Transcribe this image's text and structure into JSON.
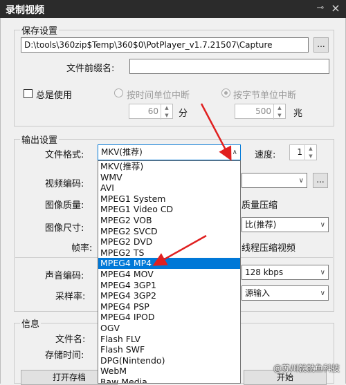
{
  "window": {
    "title": "录制视频",
    "pin_icon": "pin-icon",
    "close_icon": "close-icon"
  },
  "save": {
    "group_label": "保存设置",
    "path": "D:\\tools\\360zip$Temp\\360$0\\PotPlayer_v1.7.21507\\Capture",
    "browse_label": "...",
    "prefix_label": "文件前缀名:",
    "prefix_value": "",
    "always_use_label": "总是使用",
    "time_split_label": "按时间单位中断",
    "byte_split_label": "按字节单位中断",
    "time_value": "60",
    "time_unit": "分",
    "byte_value": "500",
    "byte_unit": "兆"
  },
  "output": {
    "group_label": "输出设置",
    "format_label": "文件格式:",
    "format_value": "MKV(推荐)",
    "speed_label": "速度:",
    "speed_value": "1",
    "video_codec_label": "视频编码:",
    "video_browse_label": "...",
    "image_quality_label": "图像质量:",
    "quality_option_label": "质量压缩",
    "image_size_label": "图像尺寸:",
    "size_value": "比(推荐)",
    "frame_rate_label": "帧率:",
    "multithread_label": "线程压缩视频",
    "audio_codec_label": "声音编码:",
    "audio_bitrate": "128 kbps",
    "sample_rate_label": "采样率:",
    "sample_value": "源输入"
  },
  "info": {
    "group_label": "信息",
    "filename_label": "文件名:",
    "storage_time_label": "存储时间:",
    "open_folder_label": "打开存档",
    "start_label": "开始"
  },
  "format_dropdown": {
    "items": [
      "MKV(推荐)",
      "WMV",
      "AVI",
      "MPEG1 System",
      "MPEG1 Video CD",
      "MPEG2 VOB",
      "MPEG2 SVCD",
      "MPEG2 DVD",
      "MPEG2 TS",
      "MPEG4 MP4",
      "MPEG4 MOV",
      "MPEG4 3GP1",
      "MPEG4 3GP2",
      "MPEG4 PSP",
      "MPEG4 IPOD",
      "OGV",
      "Flash FLV",
      "Flash SWF",
      "DPG(Nintendo)",
      "WebM",
      "Raw Media"
    ],
    "selected": "MPEG4 MP4"
  },
  "watermark": "@苏州就就鱼科技",
  "colors": {
    "titlebar": "#2b2b2b",
    "selection": "#0078d7",
    "annotation_arrow": "#e02020"
  }
}
